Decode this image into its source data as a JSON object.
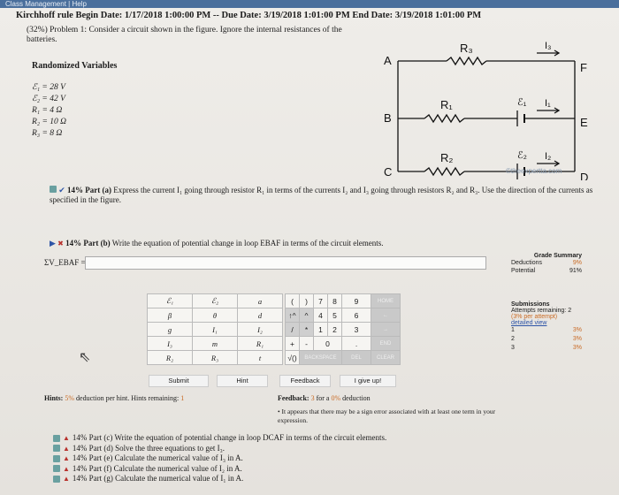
{
  "topbar": {
    "left": "Class Management",
    "sep": "|",
    "help": "Help"
  },
  "header": "Kirchhoff rule Begin Date: 1/17/2018 1:00:00 PM -- Due Date: 3/19/2018 1:01:00 PM End Date: 3/19/2018 1:01:00 PM",
  "problem": {
    "text": "(32%) Problem 1: Consider a circuit shown in the figure. Ignore the internal resistances of the batteries."
  },
  "randomized": {
    "title": "Randomized Variables",
    "vars": [
      "ℰ₁ = 28 V",
      "ℰ₂ = 42 V",
      "R₁ = 4 Ω",
      "R₂ = 10 Ω",
      "R₃ = 8 Ω"
    ]
  },
  "circuit": {
    "labels": {
      "A": "A",
      "B": "B",
      "C": "C",
      "D": "D",
      "E": "E",
      "F": "F",
      "R1": "R₁",
      "R2": "R₂",
      "R3": "R₃",
      "E1": "ℰ₁",
      "E2": "ℰ₂",
      "I1": "I₁",
      "I2": "I₂",
      "I3": "I₃"
    }
  },
  "copyright": "©theexpertta.com",
  "part_a": {
    "marker": "14% Part (a)",
    "text": "Express the current I₁ going through resistor R₁ in terms of the currents I₂ and I₃ going through resistors R₂ and R₃. Use the direction of the currents as specified in the figure."
  },
  "part_b": {
    "marker": "14% Part (b)",
    "text": "Write the equation of potential change in loop EBAF in terms of the circuit elements."
  },
  "equation": {
    "label": "ΣV_EBAF =",
    "value": ""
  },
  "grade": {
    "title": "Grade Summary",
    "rows": [
      {
        "k": "Deductions",
        "v": "9%"
      },
      {
        "k": "Potential",
        "v": "91%"
      }
    ]
  },
  "submissions": {
    "title": "Submissions",
    "remaining": "Attempts remaining: 2",
    "per_attempt": "(3% per attempt)",
    "detailed": "detailed view",
    "rows": [
      {
        "n": "1",
        "v": "3%"
      },
      {
        "n": "2",
        "v": "3%"
      },
      {
        "n": "3",
        "v": "3%"
      }
    ]
  },
  "symbols": [
    [
      "ℰ₁",
      "ℰ₂",
      "a"
    ],
    [
      "β",
      "θ",
      "d"
    ],
    [
      "g",
      "I₁",
      "I₂"
    ],
    [
      "I₃",
      "m",
      "R₁"
    ],
    [
      "R₂",
      "R₃",
      "t"
    ]
  ],
  "keypad": {
    "row1": [
      "(",
      ")",
      "7",
      "8",
      "9",
      "HOME"
    ],
    "row2": [
      "↑^",
      "^",
      "4",
      "5",
      "6",
      "←"
    ],
    "row3": [
      "/",
      "*",
      "1",
      "2",
      "3",
      "→"
    ],
    "row4": [
      "+",
      "-",
      "0",
      ".",
      "END"
    ],
    "row5": [
      "√()",
      "BACKSPACE",
      "DEL",
      "CLEAR"
    ]
  },
  "buttons": {
    "submit": "Submit",
    "hint": "Hint",
    "feedback": "Feedback",
    "give_up": "I give up!"
  },
  "hints": {
    "label": "Hints:",
    "pct": "5%",
    "text": "deduction per hint. Hints remaining:",
    "remaining": "1"
  },
  "feedback": {
    "label": "Feedback:",
    "n": "3",
    "mid": "for a",
    "pct": "0%",
    "end": "deduction"
  },
  "feedback_note": "It appears that there may be a sign error associated with at least one term in your expression.",
  "parts": [
    "14% Part (c) Write the equation of potential change in loop DCAF in terms of the circuit elements.",
    "14% Part (d) Solve the three equations to get I₃.",
    "14% Part (e) Calculate the numerical value of I₃ in A.",
    "14% Part (f) Calculate the numerical value of I₂ in A.",
    "14% Part (g) Calculate the numerical value of I₁ in A."
  ]
}
